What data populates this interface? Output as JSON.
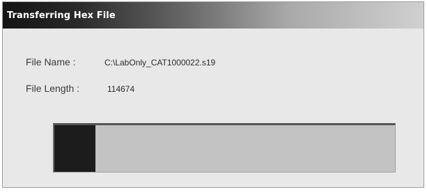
{
  "dialog": {
    "title": "Transferring Hex File",
    "file_name_label": "File Name :",
    "file_name_value": "C:\\LabOnly_CAT1000022.s19",
    "file_length_label": "File Length :",
    "file_length_value": "114674"
  },
  "progress": {
    "fraction": 0.12
  }
}
